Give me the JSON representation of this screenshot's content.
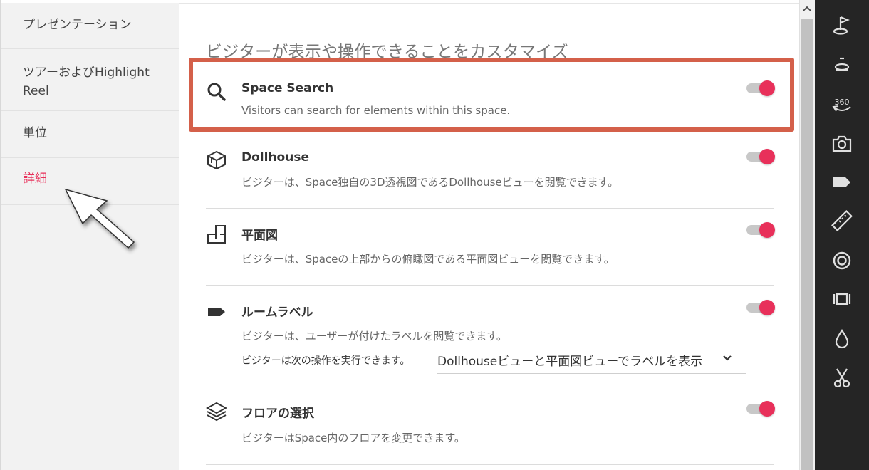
{
  "sidebar": {
    "items": [
      {
        "label": "プレゼンテーション"
      },
      {
        "label": "ツアーおよびHighlight Reel"
      },
      {
        "label": "単位"
      },
      {
        "label": "詳細"
      }
    ]
  },
  "main": {
    "heading": "ビジターが表示や操作できることをカスタマイズ",
    "settings": [
      {
        "title": "Space Search",
        "desc": "Visitors can search for elements within this space.",
        "enabled": true
      },
      {
        "title": "Dollhouse",
        "desc": "ビジターは、Space独自の3D透視図であるDollhouseビューを閲覧できます。",
        "enabled": true
      },
      {
        "title": "平面図",
        "desc": "ビジターは、Spaceの上部からの俯瞰図である平面図ビューを閲覧できます。",
        "enabled": true
      },
      {
        "title": "ルームラベル",
        "desc": "ビジターは、ユーザーが付けたラベルを閲覧できます。",
        "enabled": true,
        "action_label": "ビジターは次の操作を実行できます。",
        "select_value": "Dollhouseビューと平面図ビューでラベルを表示"
      },
      {
        "title": "フロアの選択",
        "desc": "ビジターはSpace内のフロアを変更できます。",
        "enabled": true
      }
    ]
  },
  "colors": {
    "accent": "#e8305a",
    "highlight": "#d4604a",
    "toolbar_bg": "#252525"
  },
  "toolbar": {
    "icons": [
      "flag-icon",
      "golf-pin-icon",
      "360-view-icon",
      "camera-icon",
      "tag-icon",
      "ruler-icon",
      "target-icon",
      "frame-icon",
      "droplet-icon",
      "scissors-icon"
    ],
    "label_360": "360"
  }
}
